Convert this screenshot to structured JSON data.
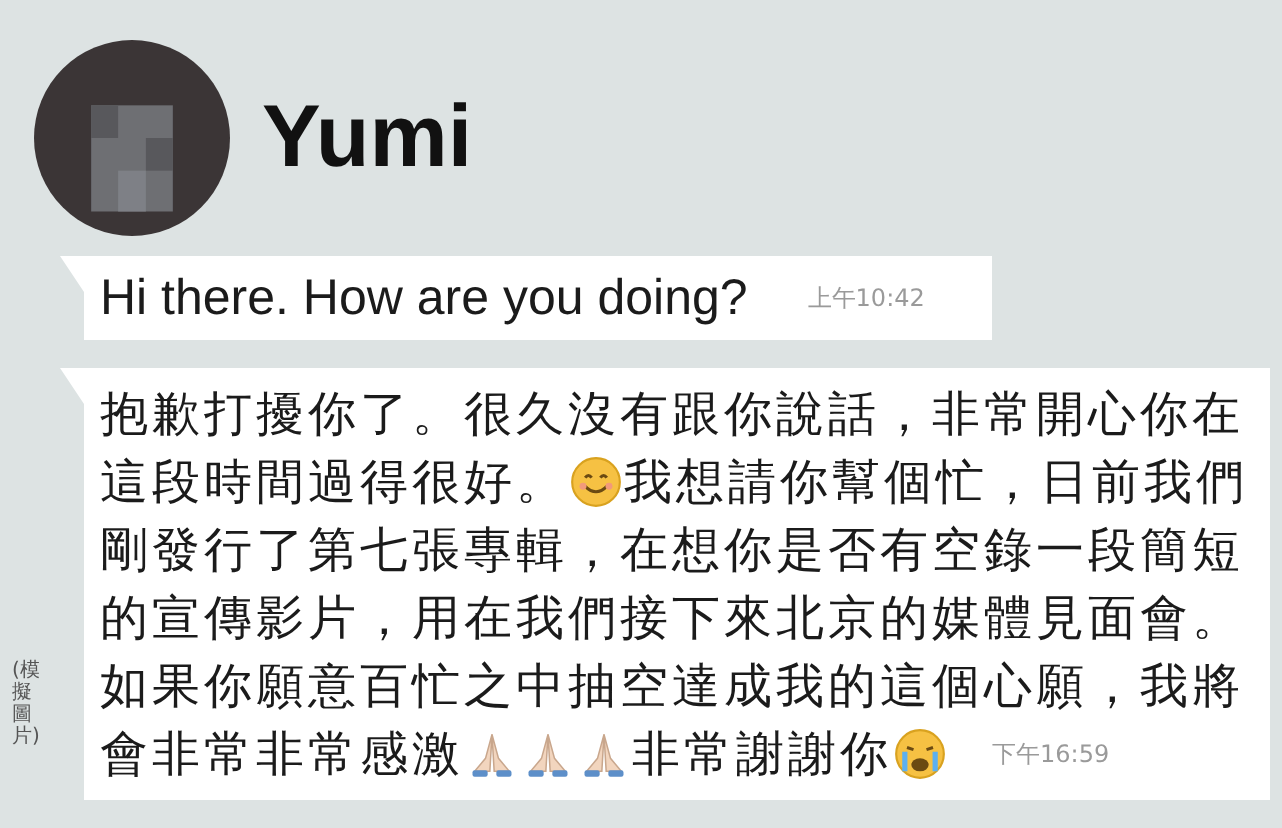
{
  "contact": {
    "name": "Yumi"
  },
  "messages": [
    {
      "time": "上午10:42",
      "lines": [
        [
          {
            "kind": "text",
            "text": "Hi there. How are you doing?"
          }
        ]
      ]
    },
    {
      "time": "下午16:59",
      "lines": [
        [
          {
            "kind": "text",
            "text": "抱歉打擾你了。很久沒有跟你說話，非常開心你在"
          }
        ],
        [
          {
            "kind": "text",
            "text": "這段時間過得很好。"
          },
          {
            "kind": "smile"
          },
          {
            "kind": "text",
            "text": "我想請你幫個忙，日前我們"
          }
        ],
        [
          {
            "kind": "text",
            "text": "剛發行了第七張專輯，在想你是否有空錄一段簡短"
          }
        ],
        [
          {
            "kind": "text",
            "text": "的宣傳影片，用在我們接下來北京的媒體見面會。"
          }
        ],
        [
          {
            "kind": "text",
            "text": "如果你願意百忙之中抽空達成我的這個心願，我將"
          }
        ],
        [
          {
            "kind": "text",
            "text": "會非常非常感激"
          },
          {
            "kind": "pray"
          },
          {
            "kind": "pray"
          },
          {
            "kind": "pray"
          },
          {
            "kind": "text",
            "text": "非常謝謝你"
          },
          {
            "kind": "cry"
          }
        ]
      ]
    }
  ],
  "side_note": "(模擬圖片)"
}
